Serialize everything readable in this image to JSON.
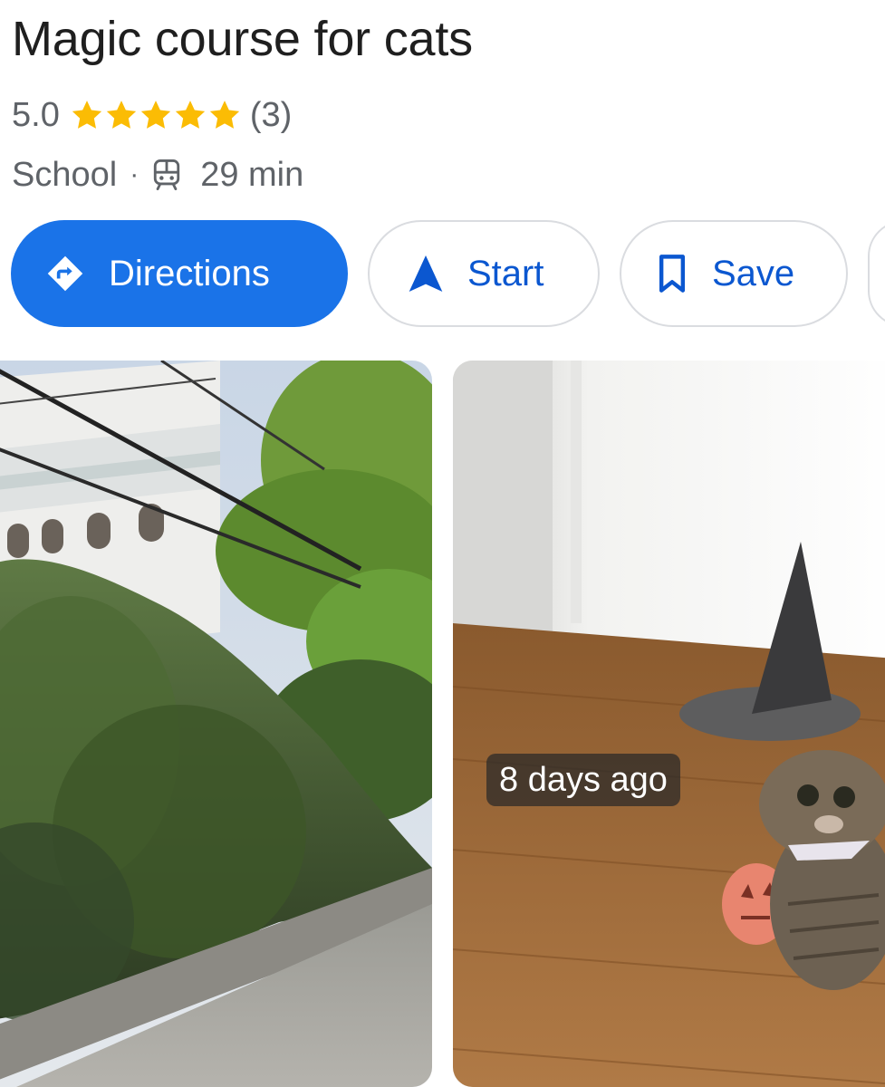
{
  "place": {
    "title": "Magic course for cats",
    "rating": "5.0",
    "stars": 5,
    "review_count": "(3)",
    "category": "School",
    "separator": "·",
    "transit_time": "29 min"
  },
  "actions": {
    "directions_label": "Directions",
    "start_label": "Start",
    "save_label": "Save"
  },
  "photos": {
    "cat_photo_age": "8 days ago"
  },
  "icons": {
    "directions": "directions-icon",
    "start": "navigation-arrow-icon",
    "save": "bookmark-icon",
    "transit": "train-icon",
    "star": "star-icon"
  },
  "colors": {
    "accent": "#1a73e8",
    "star": "#fbbc04",
    "secondary_text": "#5f6368",
    "outline_button_text": "#0b57d0"
  }
}
